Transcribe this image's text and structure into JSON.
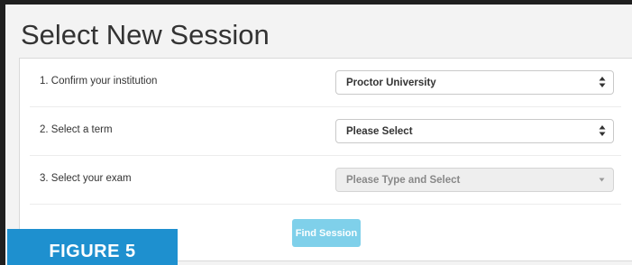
{
  "page": {
    "title": "Select New Session"
  },
  "form": {
    "rows": [
      {
        "label": "1. Confirm your institution",
        "value": "Proctor University",
        "disabled": false
      },
      {
        "label": "2. Select a term",
        "value": "Please Select",
        "disabled": false
      },
      {
        "label": "3. Select your exam",
        "value": "Please Type and Select",
        "disabled": true
      }
    ],
    "find_button_label": "Find Session"
  },
  "figure": {
    "label": "FIGURE 5"
  },
  "colors": {
    "button": "#7fd0ea",
    "figure_badge": "#1e90cf",
    "frame_border": "#1f1f1f"
  },
  "icons": {
    "select_caret": "up-down-caret-icon",
    "disabled_caret": "chevron-down-icon"
  }
}
